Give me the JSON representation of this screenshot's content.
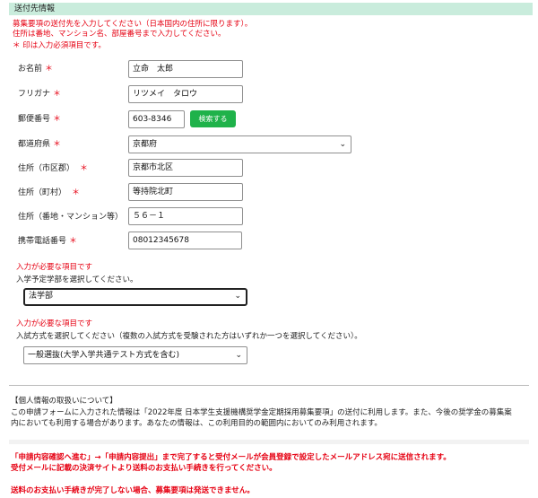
{
  "header": {
    "title": "送付先情報"
  },
  "notes": {
    "line1": "募集要項の送付先を入力してください（日本国内の住所に限ります）。",
    "line2": "住所は番地、マンション名、部屋番号まで入力してください。",
    "required_note": "＊ 印は入力必須項目です。"
  },
  "required_mark": "＊",
  "form": {
    "name": {
      "label": "お名前",
      "value": "立命　太郎"
    },
    "furigana": {
      "label": "フリガナ",
      "value": "リツメイ　タロウ"
    },
    "postal": {
      "label": "郵便番号",
      "value": "603-8346",
      "search_button": "検索する"
    },
    "prefecture": {
      "label": "都道府県",
      "selected": "京都府"
    },
    "address_city": {
      "label": "住所（市区郡）",
      "value": "京都市北区"
    },
    "address_town": {
      "label": "住所（町村）",
      "value": "等持院北町"
    },
    "address_street": {
      "label": "住所（番地・マンション等）",
      "value": "５６－１"
    },
    "phone": {
      "label": "携帯電話番号",
      "value": "08012345678"
    }
  },
  "faculty": {
    "error": "入力が必要な項目です",
    "prompt": "入学予定学部を選択してください。",
    "selected": "法学部"
  },
  "exam": {
    "error": "入力が必要な項目です",
    "prompt": "入試方式を選択してください（複数の入試方式を受験された方はいずれか一つを選択してください）。",
    "selected": "一般選抜(大学入学共通テスト方式を含む)"
  },
  "privacy": {
    "title": "【個人情報の取扱いについて】",
    "line1": "この申請フォームに入力された情報は「2022年度 日本学生支援機構奨学金定期採用募集要項」の送付に利用します。また、今後の奨学金の募集案",
    "line2": "内においても利用する場合があります。あなたの情報は、この利用目的の範囲内においてのみ利用されます。"
  },
  "notice": {
    "line1": "「申請内容確認へ進む」→「申請内容提出」まで完了すると受付メールが会員登録で設定したメールアドレス宛に送信されます。",
    "line2": "受付メールに記載の決済サイトより送料のお支払い手続きを行ってください。",
    "line3": "送料のお支払い手続きが完了しない場合、募集要項は発送できません。"
  },
  "colors": {
    "header_bg": "#c9ecdc",
    "accent_red": "#e60012",
    "button_green": "#1fb24a",
    "gray_box": "#f2f2f2"
  },
  "icons": {
    "select_arrow": "chevron-down-icon"
  }
}
